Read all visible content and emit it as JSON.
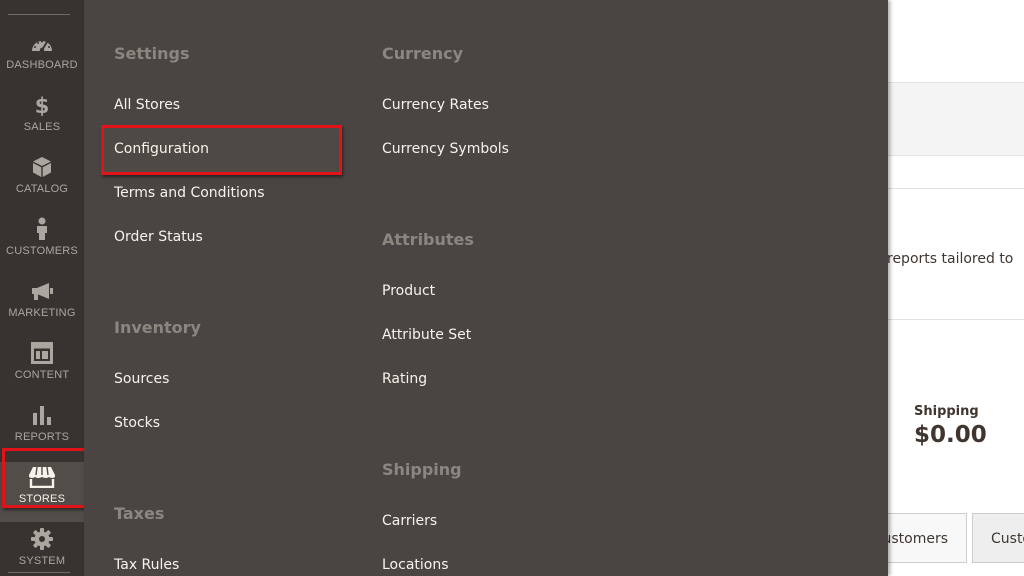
{
  "background": {
    "intro_text": "reports tailored to",
    "shipping_label": "Shipping",
    "shipping_value": "$0.00",
    "tabs": [
      "ustomers",
      "Custo"
    ]
  },
  "admin_menu": {
    "items": [
      {
        "label": "DASHBOARD",
        "icon": "dashboard-icon"
      },
      {
        "label": "SALES",
        "icon": "dollar-icon"
      },
      {
        "label": "CATALOG",
        "icon": "box-icon"
      },
      {
        "label": "CUSTOMERS",
        "icon": "person-icon"
      },
      {
        "label": "MARKETING",
        "icon": "megaphone-icon"
      },
      {
        "label": "CONTENT",
        "icon": "layout-icon"
      },
      {
        "label": "REPORTS",
        "icon": "bar-chart-icon"
      },
      {
        "label": "STORES",
        "icon": "storefront-icon",
        "active": true
      },
      {
        "label": "SYSTEM",
        "icon": "gear-icon"
      }
    ]
  },
  "stores_menu": {
    "settings": {
      "title": "Settings",
      "links": [
        "All Stores",
        "Configuration",
        "Terms and Conditions",
        "Order Status"
      ]
    },
    "inventory": {
      "title": "Inventory",
      "links": [
        "Sources",
        "Stocks"
      ]
    },
    "taxes": {
      "title": "Taxes",
      "links": [
        "Tax Rules"
      ]
    },
    "currency": {
      "title": "Currency",
      "links": [
        "Currency Rates",
        "Currency Symbols"
      ]
    },
    "attributes": {
      "title": "Attributes",
      "links": [
        "Product",
        "Attribute Set",
        "Rating"
      ]
    },
    "shipping": {
      "title": "Shipping",
      "links": [
        "Carriers",
        "Locations"
      ]
    }
  },
  "colors": {
    "menu_bg": "#373330",
    "flyout_bg": "#4a4542",
    "highlight": "#e2121a"
  }
}
